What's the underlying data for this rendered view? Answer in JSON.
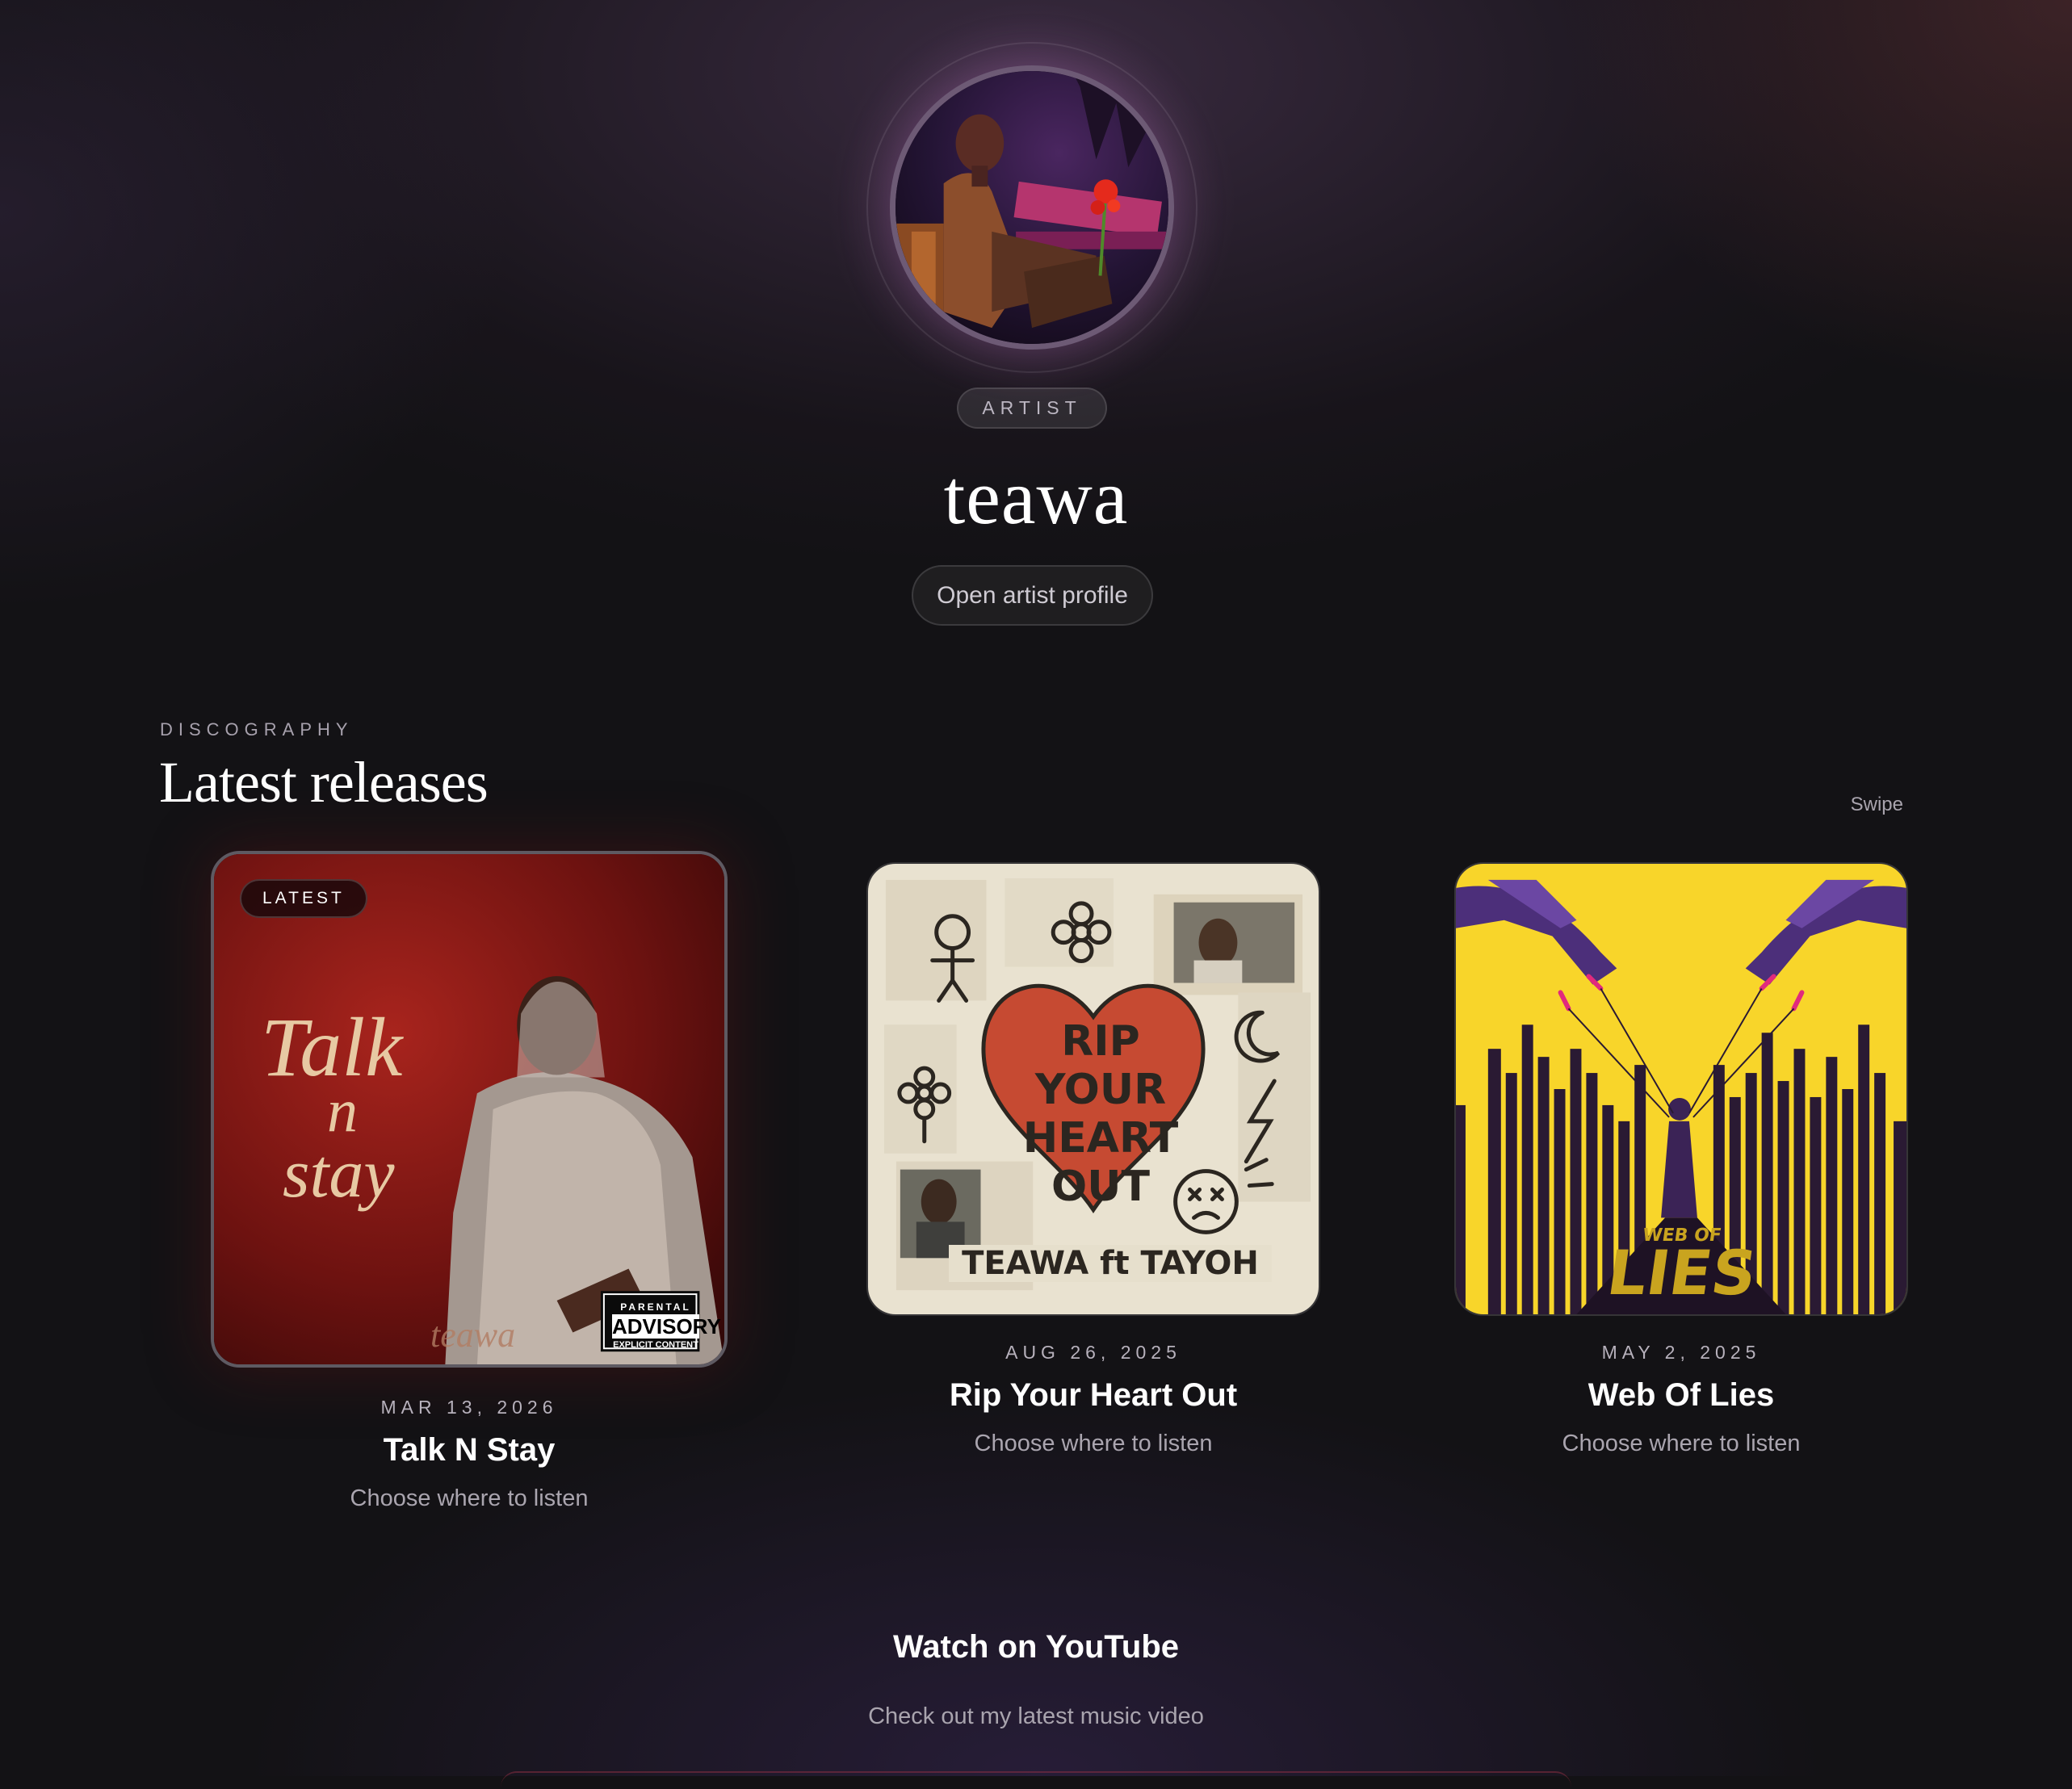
{
  "artist": {
    "role": "ARTIST",
    "name": "teawa",
    "profile_button": "Open artist profile"
  },
  "discography": {
    "eyebrow": "DISCOGRAPHY",
    "title": "Latest releases",
    "swipe_hint": "Swipe",
    "releases": [
      {
        "badge": "LATEST",
        "date": "MAR 13, 2026",
        "title": "Talk N Stay",
        "subtitle": "Choose where to listen",
        "cover_text": [
          "Talk",
          "n",
          "stay"
        ],
        "cover_signature": "teawa",
        "advisory": [
          "PARENTAL",
          "ADVISORY",
          "EXPLICIT CONTENT"
        ]
      },
      {
        "date": "AUG 26, 2025",
        "title": "Rip Your Heart Out",
        "subtitle": "Choose where to listen",
        "cover_text": [
          "RIP",
          "YOUR",
          "HEART",
          "OUT"
        ],
        "cover_credit": "TEAWA ft TAYOH"
      },
      {
        "date": "MAY 2, 2025",
        "title": "Web Of Lies",
        "subtitle": "Choose where to listen",
        "cover_text": [
          "WEB OF",
          "LIES"
        ]
      }
    ]
  },
  "youtube": {
    "title": "Watch on YouTube",
    "subtitle": "Check out my latest music video"
  },
  "colors": {
    "background": "#131215",
    "accent_yellow": "#f8d52a",
    "heart_red": "#c64a32",
    "talk_red": "#7c1414"
  }
}
